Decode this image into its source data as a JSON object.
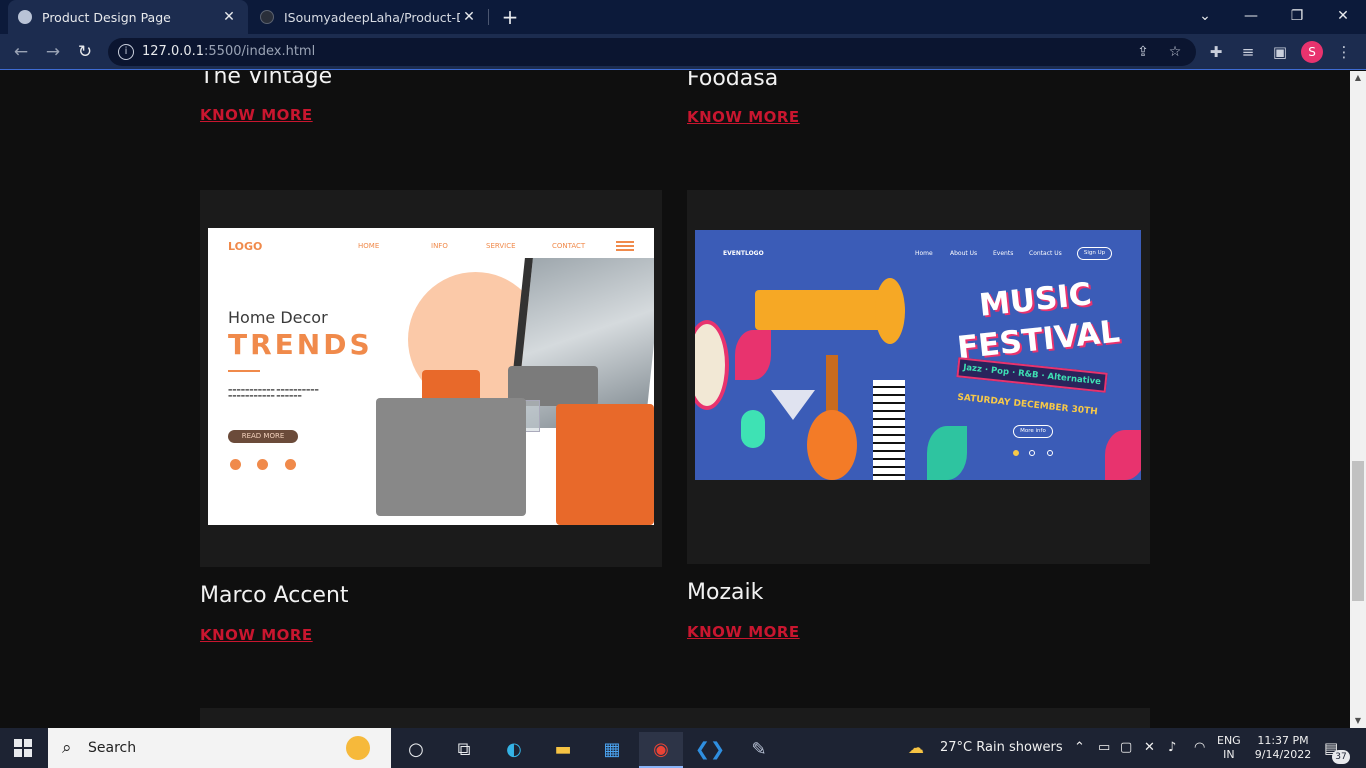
{
  "browser": {
    "tabs": [
      {
        "title": "Product Design Page",
        "active": true
      },
      {
        "title": "ISoumyadeepLaha/Product-Design",
        "active": false
      }
    ],
    "url_host": "127.0.0.1",
    "url_rest": ":5500/index.html",
    "profile_initial": "S"
  },
  "page": {
    "cards": [
      {
        "title": "The Vintage",
        "link": "KNOW MORE"
      },
      {
        "title": "Foodasa",
        "link": "KNOW MORE"
      },
      {
        "title": "Marco Accent",
        "link": "KNOW MORE"
      },
      {
        "title": "Mozaik",
        "link": "KNOW MORE"
      }
    ],
    "home_decor_mock": {
      "logo": "LOGO",
      "nav": [
        "HOME",
        "INFO",
        "SERVICE",
        "CONTACT"
      ],
      "heading": "Home  Decor",
      "heading_big": "TRENDS",
      "button": "READ MORE"
    },
    "music_mock": {
      "logo": "EVENTLOGO",
      "nav": [
        "Home",
        "About Us",
        "Events",
        "Contact Us"
      ],
      "signup": "Sign Up",
      "title_line1": "MUSIC",
      "title_line2": "FESTIVAL",
      "genres": "Jazz · Pop · R&B · Alternative",
      "date": "SATURDAY DECEMBER 30TH",
      "more": "More info"
    }
  },
  "taskbar": {
    "search_label": "Search",
    "weather": "27°C  Rain showers",
    "lang_top": "ENG",
    "lang_bottom": "IN",
    "time": "11:37 PM",
    "date": "9/14/2022",
    "notifications": "37"
  },
  "colors": {
    "accent_link": "#c9162f",
    "page_bg": "#0f0f0f",
    "card_bg": "#1b1b1b"
  }
}
